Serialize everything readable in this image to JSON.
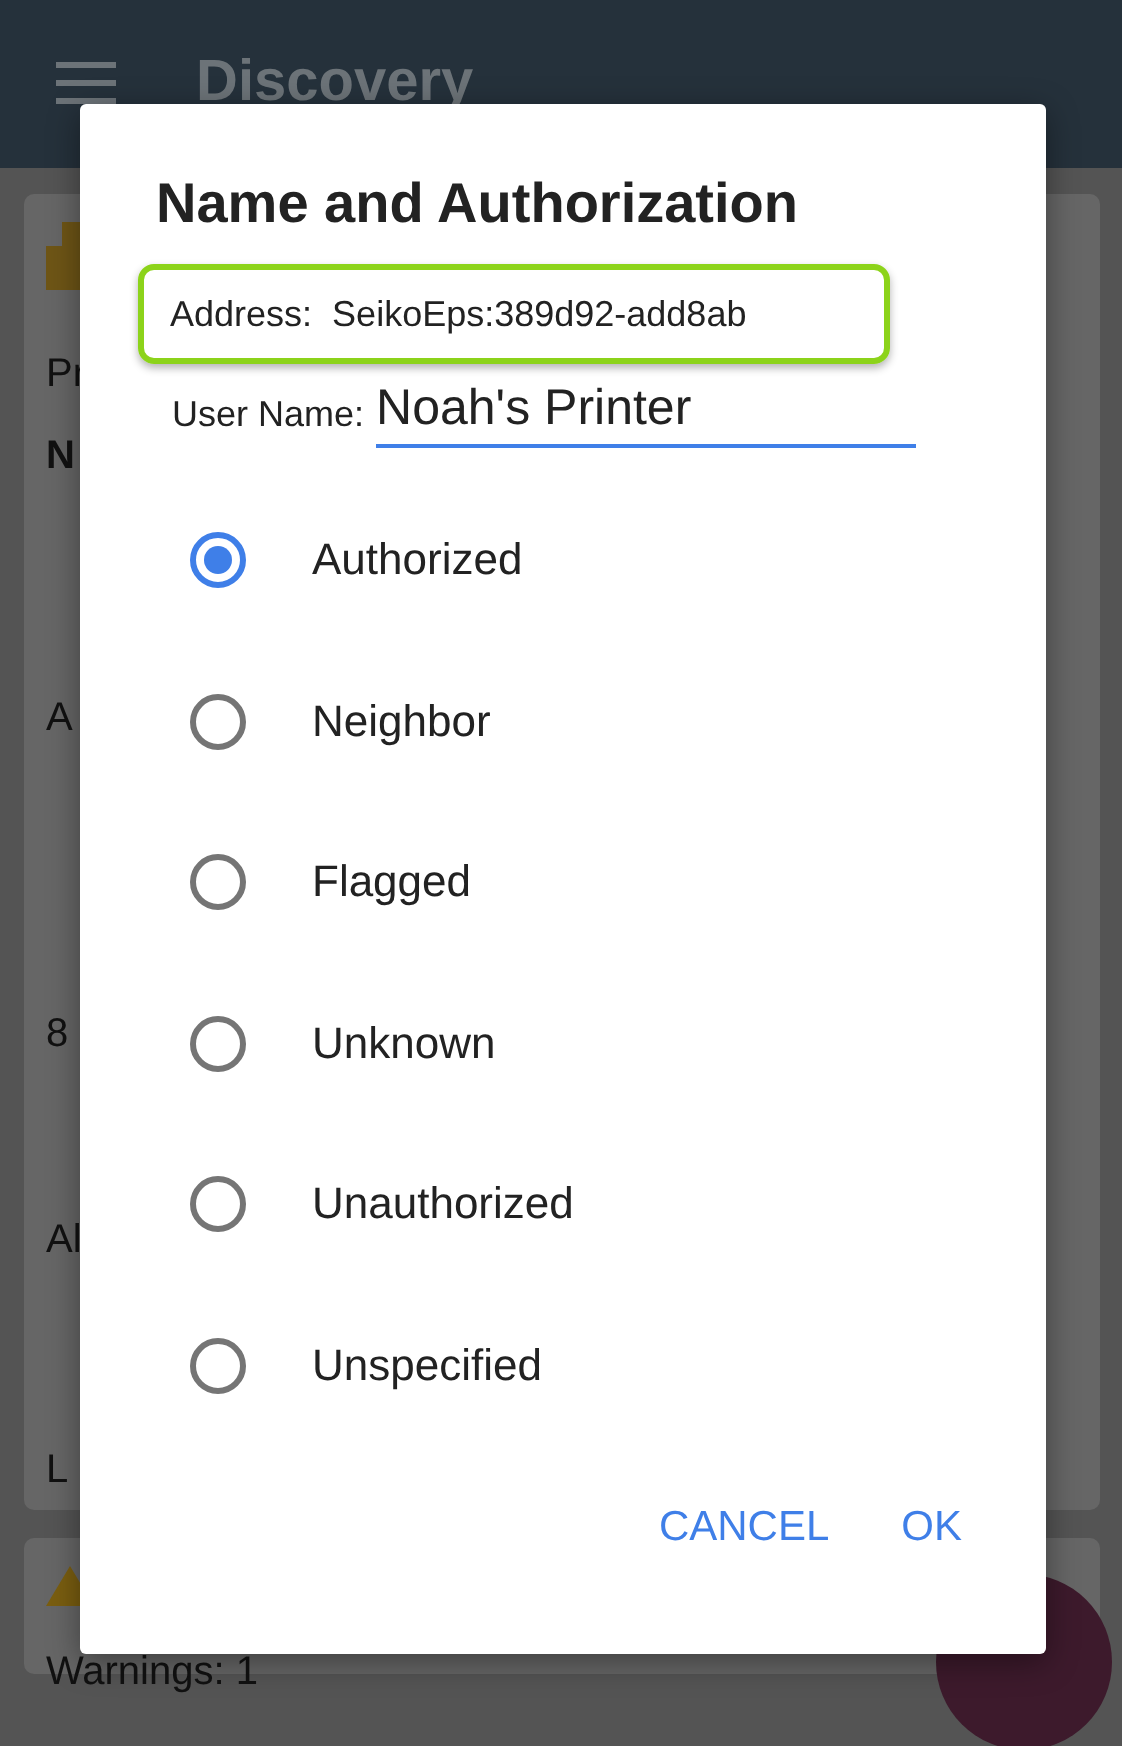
{
  "app_bar": {
    "title": "Discovery"
  },
  "device_card": {
    "labels": [
      {
        "text": "Pr",
        "kind": "plain"
      },
      {
        "text": "N",
        "kind": "heading"
      },
      {
        "text": "A",
        "kind": "plain"
      },
      {
        "text": "8",
        "kind": "plain"
      },
      {
        "text": "Al",
        "kind": "plain"
      },
      {
        "text": "L",
        "kind": "plain"
      }
    ]
  },
  "warning_card": {
    "text": "Warnings:  1"
  },
  "dialog": {
    "title": "Name and Authorization",
    "address_label": "Address:",
    "address_value": "SeikoEps:389d92-add8ab",
    "user_name_label": "User Name:",
    "user_name_value": "Noah's Printer",
    "options": [
      {
        "label": "Authorized",
        "selected": true
      },
      {
        "label": "Neighbor",
        "selected": false
      },
      {
        "label": "Flagged",
        "selected": false
      },
      {
        "label": "Unknown",
        "selected": false
      },
      {
        "label": "Unauthorized",
        "selected": false
      },
      {
        "label": "Unspecified",
        "selected": false
      }
    ],
    "buttons": [
      "CANCEL",
      "OK"
    ]
  }
}
